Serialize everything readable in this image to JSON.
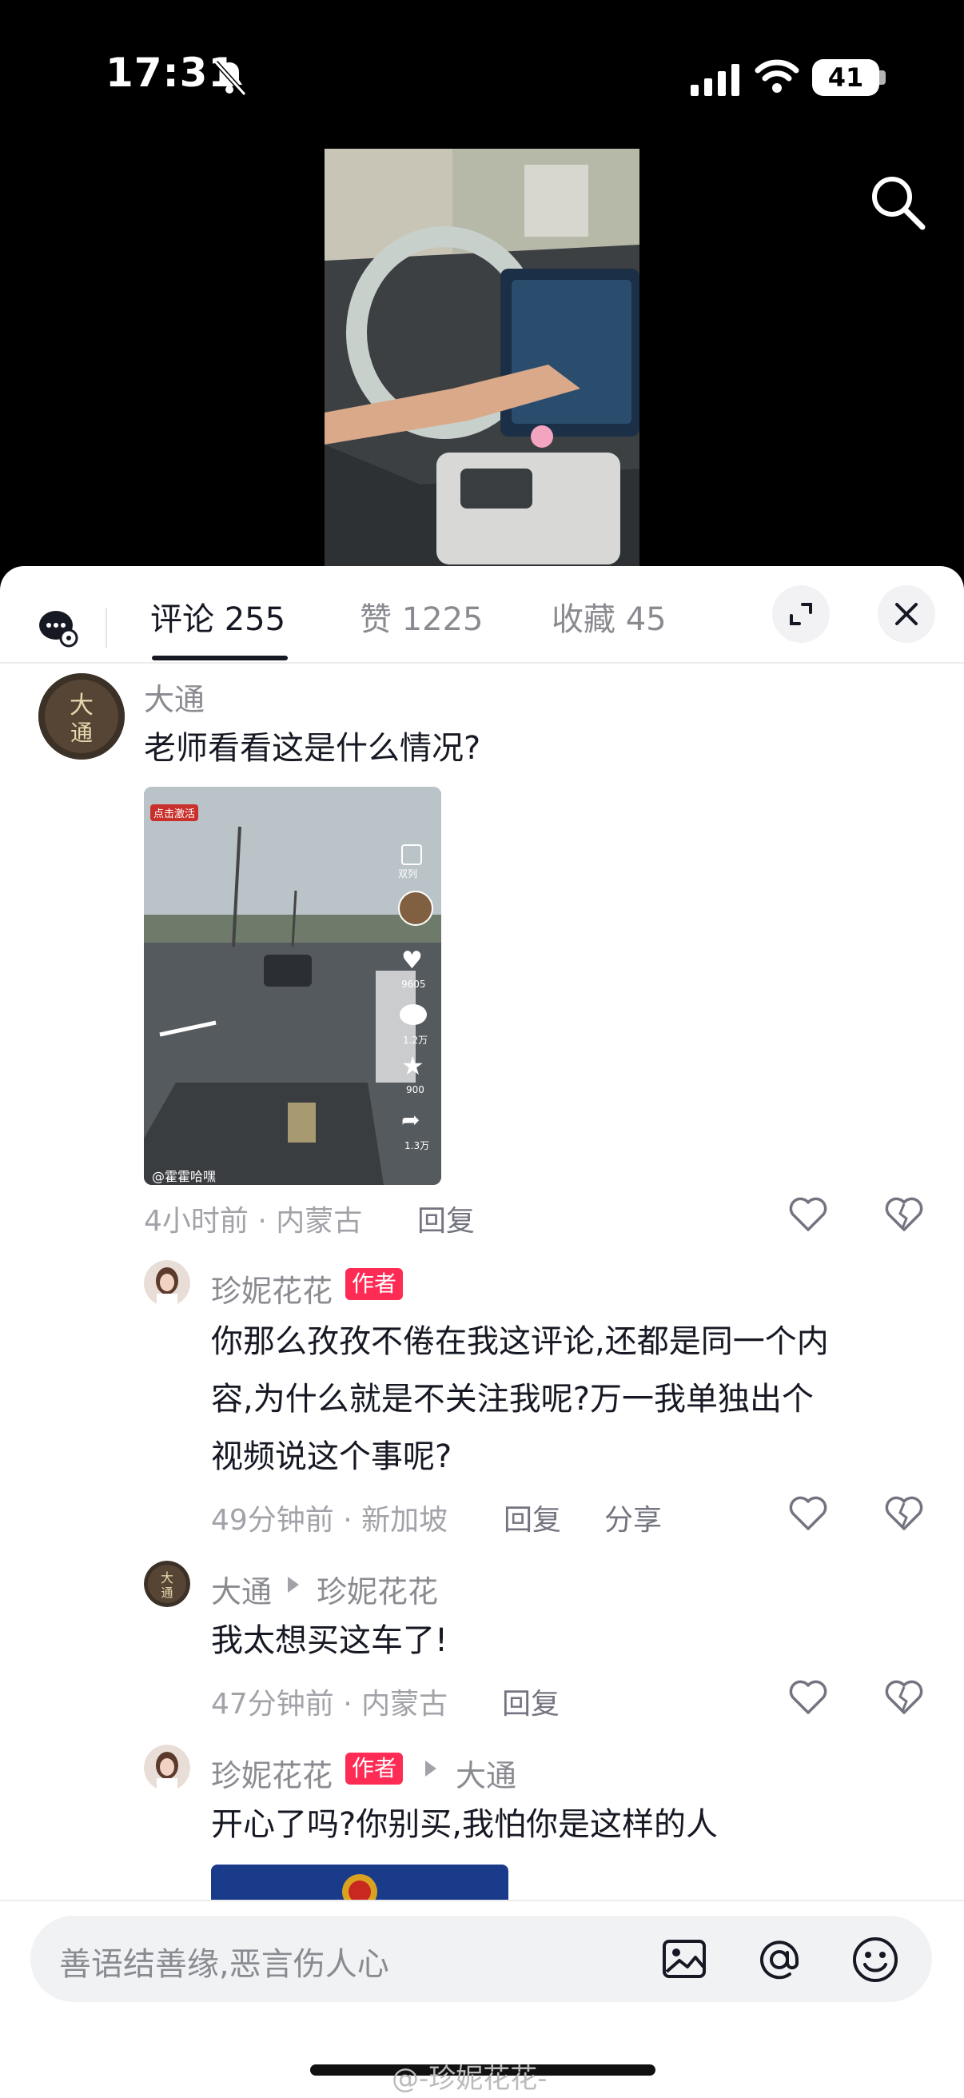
{
  "status": {
    "time": "17:31",
    "battery": "41"
  },
  "tabs": {
    "comments": "评论 255",
    "likes": "赞 1225",
    "favorites": "收藏 45"
  },
  "comments": [
    {
      "user": "大通",
      "text": "老师看看这是什么情况?",
      "embedded_video": {
        "tag": "点击激活",
        "corner": "双列",
        "likes": "9605",
        "comments": "1.2万",
        "stars": "900",
        "shares": "1.3万",
        "handle": "@霍霍哈嘿"
      },
      "meta": "4小时前 · 内蒙古",
      "reply": "回复"
    },
    {
      "user": "珍妮花花",
      "badge": "作者",
      "text_lines": [
        "你那么孜孜不倦在我这评论,还都是同一个内",
        "容,为什么就是不关注我呢?万一我单独出个",
        "视频说这个事呢?"
      ],
      "meta": "49分钟前 · 新加坡",
      "reply": "回复",
      "share": "分享"
    },
    {
      "user": "大通",
      "reply_to": "珍妮花花",
      "text": "我太想买这车了!",
      "meta": "47分钟前 · 内蒙古",
      "reply": "回复"
    },
    {
      "user": "珍妮花花",
      "badge": "作者",
      "reply_to": "大通",
      "text": "开心了吗?你别买,我怕你是这样的人"
    }
  ],
  "input": {
    "placeholder": "善语结善缘,恶言伤人心"
  },
  "watermark": "@-珍妮花花-",
  "colors": {
    "accent": "#fe2c55",
    "text": "#161823",
    "muted": "#8a8b91"
  }
}
